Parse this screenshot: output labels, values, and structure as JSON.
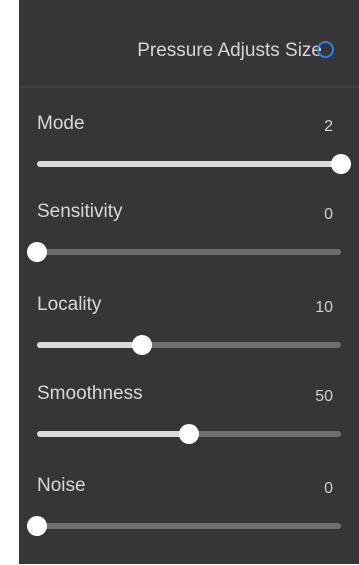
{
  "pressure": {
    "label": "Pressure Adjusts Size",
    "selected": false,
    "accent_color": "#2f7ff0"
  },
  "sliders": [
    {
      "label": "Mode",
      "value": "2",
      "fraction": 1.0
    },
    {
      "label": "Sensitivity",
      "value": "0",
      "fraction": 0.0
    },
    {
      "label": "Locality",
      "value": "10",
      "fraction": 0.345
    },
    {
      "label": "Smoothness",
      "value": "50",
      "fraction": 0.5
    },
    {
      "label": "Noise",
      "value": "0",
      "fraction": 0.0
    }
  ],
  "colors": {
    "panel_bg": "#363636",
    "track": "#6e6e6e",
    "track_fill": "#dadada",
    "thumb": "#ffffff"
  }
}
